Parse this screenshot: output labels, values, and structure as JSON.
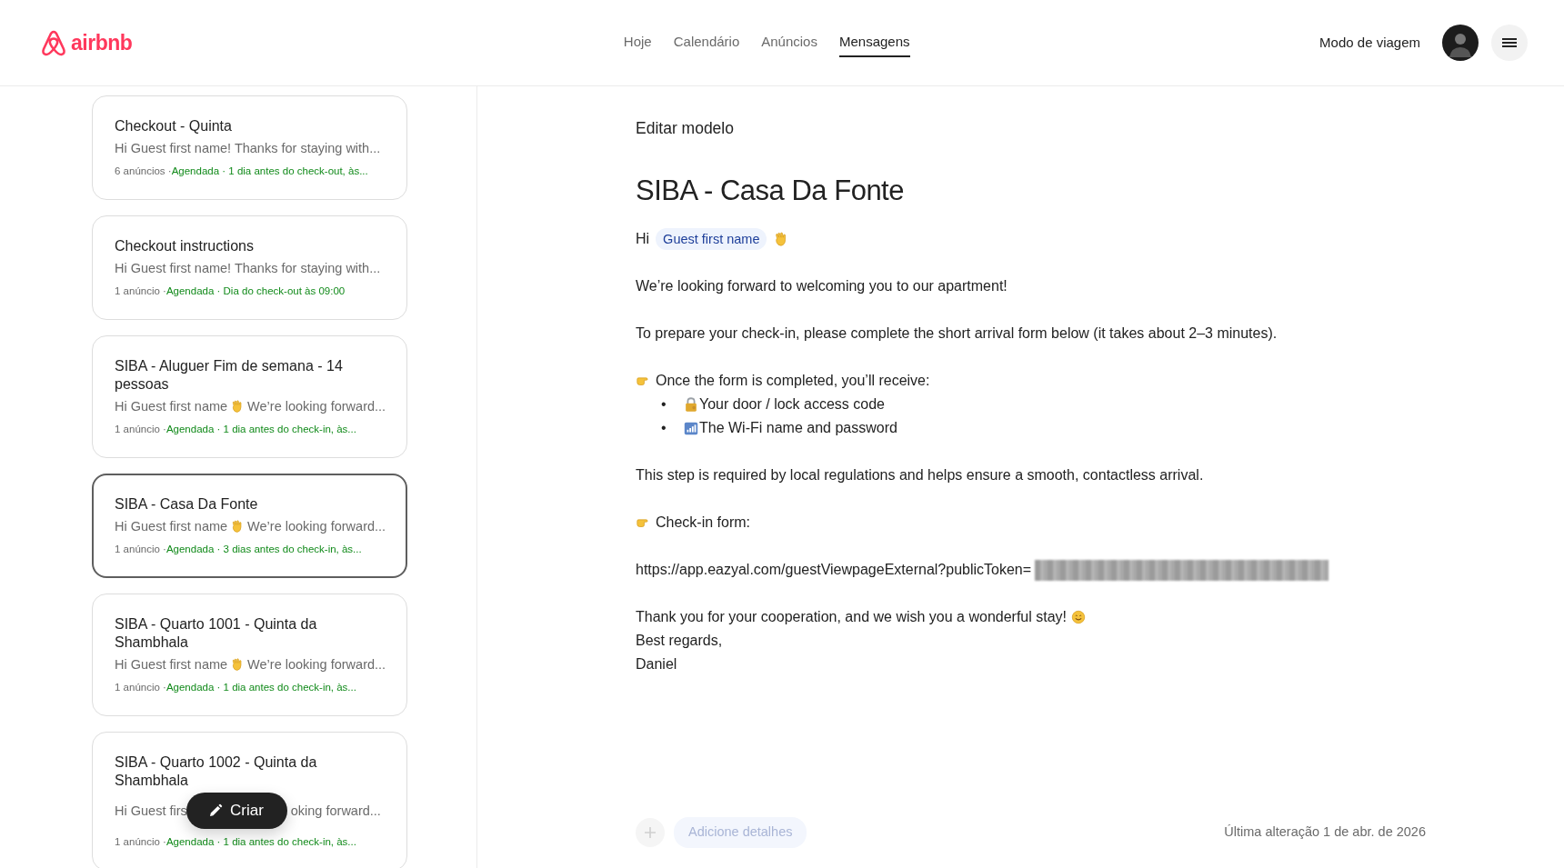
{
  "header": {
    "brand": "airbnb",
    "nav": [
      {
        "label": "Hoje",
        "selected": false
      },
      {
        "label": "Calendário",
        "selected": false
      },
      {
        "label": "Anúncios",
        "selected": false
      },
      {
        "label": "Mensagens",
        "selected": true
      }
    ],
    "travel_mode": "Modo de viagem"
  },
  "templates": [
    {
      "title": "Checkout - Quinta",
      "selected": false,
      "preview": [
        {
          "kind": "text",
          "text": "Hi Guest first name! Thanks for staying with..."
        }
      ],
      "count": "6 anúncios · ",
      "schedule": "Agendada · 1 dia antes do check-out, às..."
    },
    {
      "title": "Checkout instructions",
      "selected": false,
      "preview": [
        {
          "kind": "text",
          "text": "Hi Guest first name! Thanks for staying with..."
        }
      ],
      "count": "1 anúncio · ",
      "schedule": "Agendada · Dia do check-out às 09:00"
    },
    {
      "title": "SIBA - Aluguer Fim de semana - 14 pessoas",
      "selected": false,
      "preview": [
        {
          "kind": "text",
          "text": "Hi Guest first name"
        },
        {
          "kind": "wave"
        },
        {
          "kind": "text",
          "text": "We’re looking forward..."
        }
      ],
      "count": "1 anúncio · ",
      "schedule": "Agendada · 1 dia antes do check-in, às..."
    },
    {
      "title": "SIBA - Casa Da Fonte",
      "selected": true,
      "preview": [
        {
          "kind": "text",
          "text": "Hi Guest first name"
        },
        {
          "kind": "wave"
        },
        {
          "kind": "text",
          "text": "We’re looking forward..."
        }
      ],
      "count": "1 anúncio · ",
      "schedule": "Agendada · 3 dias antes do check-in, às..."
    },
    {
      "title": "SIBA - Quarto 1001 - Quinta da Shambhala",
      "selected": false,
      "preview": [
        {
          "kind": "text",
          "text": "Hi Guest first name"
        },
        {
          "kind": "wave"
        },
        {
          "kind": "text",
          "text": "We’re looking forward..."
        }
      ],
      "count": "1 anúncio · ",
      "schedule": "Agendada · 1 dia antes do check-in, às..."
    },
    {
      "title": "SIBA - Quarto 1002 - Quinta da Shambhala",
      "selected": false,
      "overlaid": true,
      "preview": [
        {
          "kind": "text",
          "text": "Hi Guest firs"
        },
        {
          "kind": "text",
          "text": "oking forward..."
        }
      ],
      "count": "1 anúncio · ",
      "schedule": "Agendada · 1 dia antes do check-in, às..."
    }
  ],
  "create_button": "Criar",
  "editor": {
    "heading": "Editar modelo",
    "title": "SIBA - Casa Da Fonte",
    "blocks": [
      [
        {
          "kind": "line",
          "parts": [
            {
              "kind": "text",
              "text": "Hi"
            },
            {
              "kind": "chip",
              "text": "Guest first name"
            },
            {
              "kind": "wave"
            }
          ]
        }
      ],
      [
        {
          "kind": "line",
          "parts": [
            {
              "kind": "text",
              "text": "We’re looking forward to welcoming you to our apartment!"
            }
          ]
        }
      ],
      [
        {
          "kind": "line",
          "parts": [
            {
              "kind": "text",
              "text": "To prepare your check-in, please complete the short arrival form below (it takes about 2–3 minutes)."
            }
          ]
        }
      ],
      [
        {
          "kind": "line",
          "parts": [
            {
              "kind": "point"
            },
            {
              "kind": "text",
              "text": "Once the form is completed, you’ll  receive:"
            }
          ]
        },
        {
          "kind": "bullet",
          "bullet": "•",
          "parts": [
            {
              "kind": "lock"
            },
            {
              "kind": "text",
              "text": "Your door / lock access code"
            }
          ]
        },
        {
          "kind": "bullet",
          "bullet": "•",
          "parts": [
            {
              "kind": "signal"
            },
            {
              "kind": "text",
              "text": "The Wi-Fi name and password"
            }
          ]
        }
      ],
      [
        {
          "kind": "line",
          "parts": [
            {
              "kind": "text",
              "text": "This step is required by local regulations and helps ensure a smooth, contactless arrival."
            }
          ]
        }
      ],
      [
        {
          "kind": "line",
          "parts": [
            {
              "kind": "point"
            },
            {
              "kind": "text",
              "text": "Check-in form:"
            }
          ]
        }
      ],
      [
        {
          "kind": "line",
          "parts": [
            {
              "kind": "text",
              "text": "https://app.eazyal.com/guestViewpageExternal?publicToken="
            },
            {
              "kind": "redacted"
            }
          ]
        }
      ],
      [
        {
          "kind": "line",
          "parts": [
            {
              "kind": "text",
              "text": "Thank you for your cooperation, and we wish you a wonderful stay!"
            },
            {
              "kind": "smile"
            }
          ]
        },
        {
          "kind": "line",
          "parts": [
            {
              "kind": "text",
              "text": "Best regards,"
            }
          ]
        },
        {
          "kind": "line",
          "parts": [
            {
              "kind": "text",
              "text": "Daniel"
            }
          ]
        }
      ]
    ],
    "add_details": {
      "label": "Adicione detalhes",
      "disabled": true
    },
    "last_modified": "Última alteração 1 de abr. de 2026"
  }
}
